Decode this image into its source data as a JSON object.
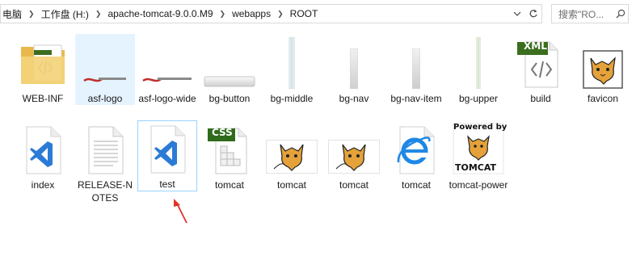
{
  "address": {
    "crumbs": [
      "电脑",
      "工作盘 (H:)",
      "apache-tomcat-9.0.0.M9",
      "webapps",
      "ROOT"
    ]
  },
  "search": {
    "placeholder": "搜索\"RO..."
  },
  "icons": {
    "chevron": "chevron-down-icon",
    "refresh": "refresh-icon",
    "search": "search-icon"
  },
  "files": [
    {
      "label": "WEB-INF",
      "type": "folder"
    },
    {
      "label": "asf-logo",
      "type": "gif-logo"
    },
    {
      "label": "asf-logo-wide",
      "type": "gif-logo"
    },
    {
      "label": "bg-button",
      "type": "image-bar"
    },
    {
      "label": "bg-middle",
      "type": "image-thin"
    },
    {
      "label": "bg-nav",
      "type": "image-thin"
    },
    {
      "label": "bg-nav-item",
      "type": "image-thin"
    },
    {
      "label": "bg-upper",
      "type": "image-thin"
    },
    {
      "label": "build",
      "type": "xml"
    },
    {
      "label": "favicon",
      "type": "tomcat"
    },
    {
      "label": "index",
      "type": "vscode"
    },
    {
      "label": "RELEASE-NOTES",
      "type": "text"
    },
    {
      "label": "test",
      "type": "vscode"
    },
    {
      "label": "tomcat",
      "type": "css"
    },
    {
      "label": "tomcat",
      "type": "tomcat"
    },
    {
      "label": "tomcat",
      "type": "tomcat"
    },
    {
      "label": "tomcat",
      "type": "ie"
    },
    {
      "label": "tomcat-power",
      "type": "tomcat-power"
    }
  ],
  "badges": {
    "xml": "XML",
    "css": "CSS",
    "powered_by": "Powered by",
    "tomcat": "TOMCAT"
  },
  "colors": {
    "folder": "#f3d27a",
    "vscode": "#2b7bd6",
    "xml_badge": "#3b6e1e",
    "css_badge": "#2f6b1a",
    "selection": "#e5f3ff",
    "focus_border": "#99d1ff",
    "arrow": "#e0332a"
  }
}
